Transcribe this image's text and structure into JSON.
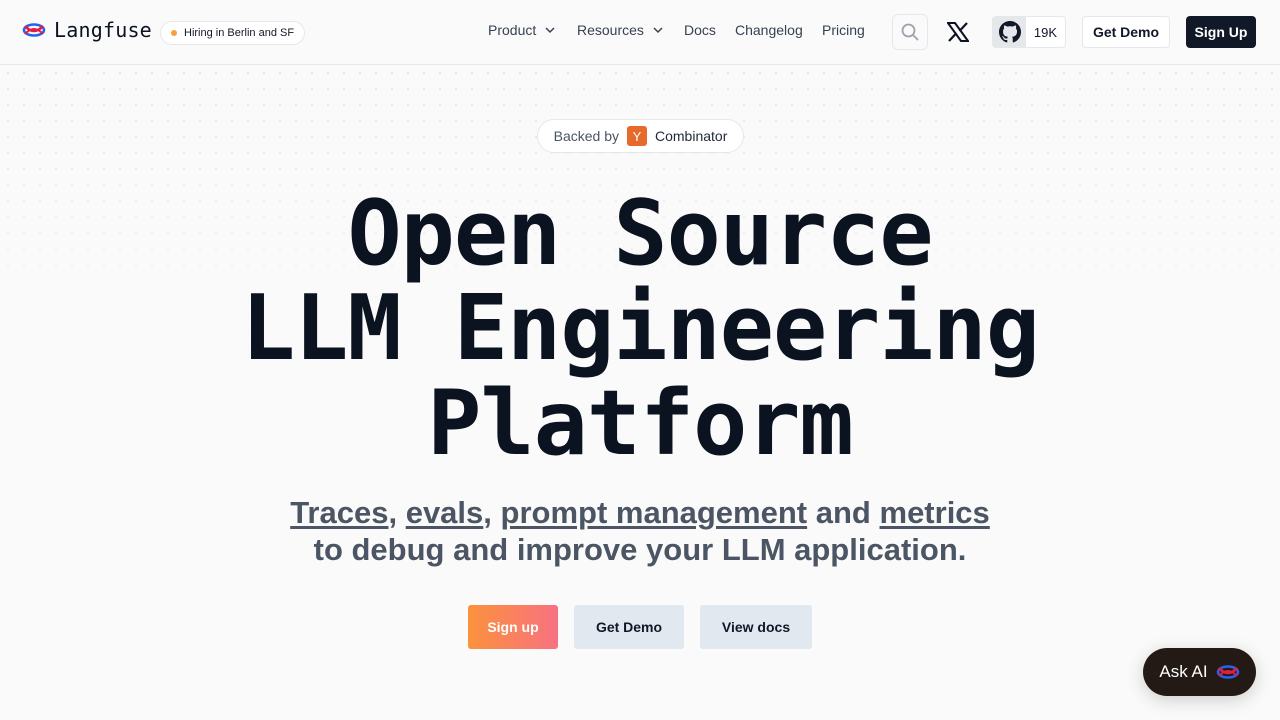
{
  "nav": {
    "logo_text": "Langfuse",
    "hiring_badge": "Hiring in Berlin and SF",
    "menu": [
      {
        "label": "Product",
        "has_dropdown": true
      },
      {
        "label": "Resources",
        "has_dropdown": true
      },
      {
        "label": "Docs"
      },
      {
        "label": "Changelog"
      },
      {
        "label": "Pricing"
      }
    ],
    "search_icon": "search-icon",
    "x_icon": "x-logo-icon",
    "github": {
      "icon": "github-icon",
      "count": "19K"
    },
    "get_demo": "Get Demo",
    "sign_up": "Sign Up"
  },
  "hero": {
    "backed_by": "Backed by",
    "yc_letter": "Y",
    "yc_name": "Combinator",
    "headline": [
      "Open Source",
      "LLM Engineering",
      "Platform"
    ],
    "sub": {
      "link_traces": "Traces",
      "link_evals": "evals",
      "link_prompt": "prompt management",
      "and": "and",
      "link_metrics": "metrics",
      "line2": "to debug and improve your LLM application."
    },
    "cta": {
      "sign_up": "Sign up",
      "get_demo": "Get Demo",
      "view_docs": "View docs"
    }
  },
  "ask_ai": {
    "label": "Ask AI",
    "icon": "langfuse-logo-icon"
  },
  "colors": {
    "accent_gradient_start": "#fb923c",
    "accent_gradient_end": "#f87181",
    "primary_dark": "#111827",
    "yc_orange": "#e56a2c"
  }
}
